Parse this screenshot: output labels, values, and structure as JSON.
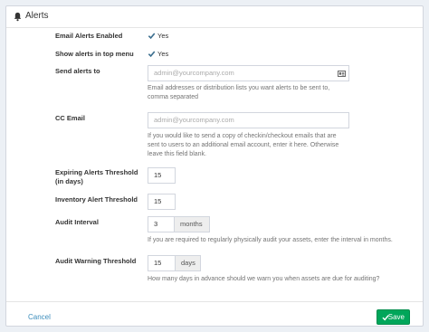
{
  "header": {
    "title": "Alerts",
    "icon": "bell-icon"
  },
  "fields": {
    "email_alerts": {
      "label": "Email Alerts Enabled",
      "value": "Yes"
    },
    "show_alerts_menu": {
      "label": "Show alerts in top menu",
      "value": "Yes"
    },
    "send_alerts_to": {
      "label": "Send alerts to",
      "placeholder": "admin@yourcompany.com",
      "help": [
        "Email addresses or distribution lists you want alerts to be sent to,",
        "comma separated"
      ]
    },
    "cc_email": {
      "label": "CC Email",
      "placeholder": "admin@yourcompany.com",
      "help": [
        "If you would like to send a copy of checkin/checkout emails that are",
        "sent to users to an additional email account, enter it here. Otherwise",
        "leave this field blank."
      ]
    },
    "expiring_threshold": {
      "label_line1": "Expiring Alerts Threshold",
      "label_line2": "(in days)",
      "value": "15"
    },
    "inventory_threshold": {
      "label": "Inventory Alert Threshold",
      "value": "15"
    },
    "audit_interval": {
      "label": "Audit Interval",
      "value": "3",
      "unit": "months",
      "help": "If you are required to regularly physically audit your assets, enter the interval in months."
    },
    "audit_warning": {
      "label": "Audit Warning Threshold",
      "value": "15",
      "unit": "days",
      "help": "How many days in advance should we warn you when assets are due for auditing?"
    }
  },
  "footer": {
    "cancel_label": "Cancel",
    "save_label": "Save"
  },
  "colors": {
    "accent": "#3c8dbc",
    "save": "#00a65a",
    "check": "#3c6f8f"
  }
}
